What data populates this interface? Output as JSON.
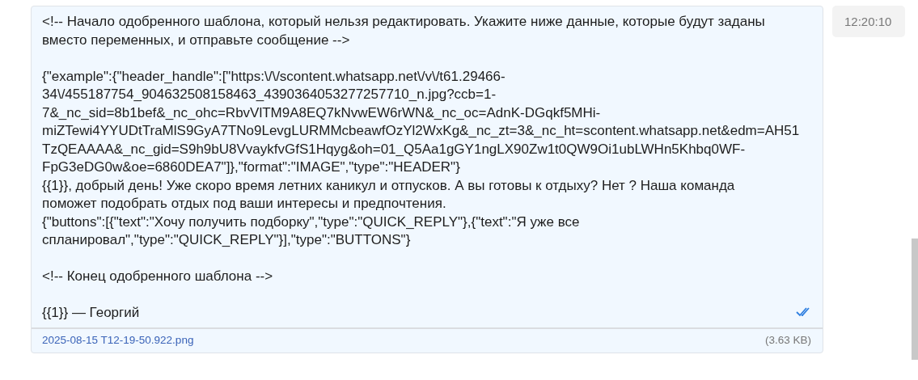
{
  "message": {
    "paragraphs": [
      {
        "blocks": [
          {
            "lines": [
              "<!-- Начало одобренного шаблона, который нельзя редактировать. Укажите ниже данные, которые будут заданы",
              "вместо переменных, и отправьте сообщение -->"
            ]
          }
        ]
      },
      {
        "blocks": [
          {
            "lines": [
              "{\"example\":{\"header_handle\":[\"https:\\/\\/scontent.whatsapp.net\\/v\\/t61.29466-",
              "34\\/455187754_904632508158463_4390364053277257710_n.jpg?ccb=1-",
              "7&_nc_sid=8b1bef&_nc_ohc=RbvVlTM9A8EQ7kNvwEW6rWN&_nc_oc=AdnK-DGqkf5MHi-",
              "miZTewi4YYUDtTraMlS9GyA7TNo9LevgLURMMcbeawfOzYl2WxKg&_nc_zt=3&_nc_ht=scontent.whatsapp.net&edm=AH51",
              "TzQEAAAA&_nc_gid=S9h9bU8VvaykfvGfS1Hqyg&oh=01_Q5Aa1gGY1ngLX90Zw1t0QW9Oi1ubLWHn5Khbq0WF-",
              "FpG3eDG0w&oe=6860DEA7\"]},\"format\":\"IMAGE\",\"type\":\"HEADER\"}"
            ]
          },
          {
            "lines": [
              "{{1}}, добрый день! Уже скоро время летних каникул и отпусков. А вы готовы к отдыху? Нет ? Наша команда",
              "поможет подобрать отдых под ваши интересы и предпочтения."
            ]
          },
          {
            "lines": [
              "{\"buttons\":[{\"text\":\"Хочу получить подборку\",\"type\":\"QUICK_REPLY\"},{\"text\":\"Я уже все",
              "спланировал\",\"type\":\"QUICK_REPLY\"}],\"type\":\"BUTTONS\"}"
            ]
          }
        ]
      },
      {
        "blocks": [
          {
            "lines": [
              "<!-- Конец одобренного шаблона -->"
            ]
          }
        ]
      },
      {
        "blocks": [
          {
            "lines": [
              "{{1}} — Георгий"
            ]
          }
        ]
      }
    ],
    "read": true,
    "attachment": {
      "name": "2025-08-15 T12-19-50.922.png",
      "size": "(3.63 KB)"
    }
  },
  "time": "12:20:10"
}
